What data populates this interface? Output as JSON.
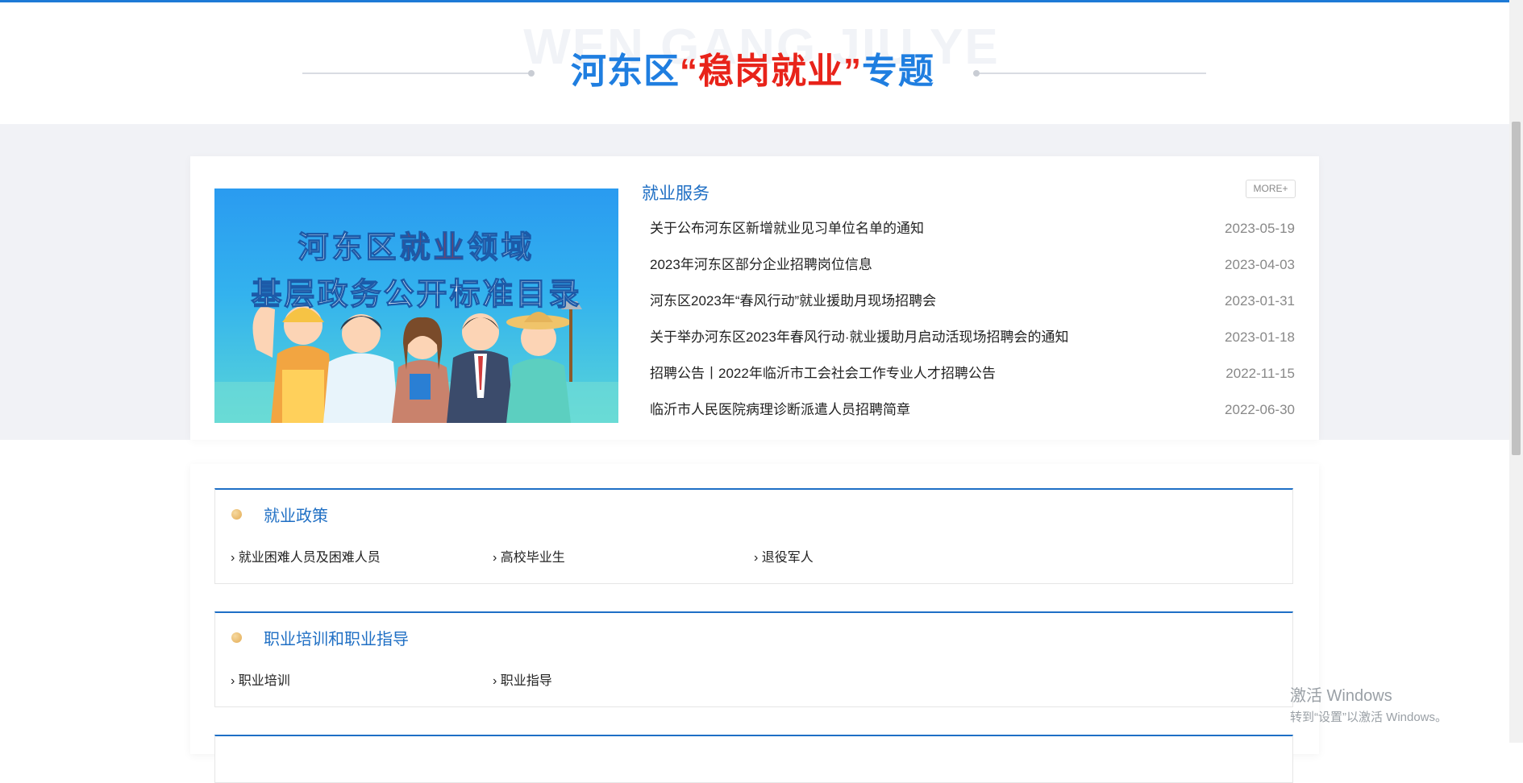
{
  "header": {
    "watermark": "WEN GANG JIU YE",
    "title_part1": "河东区",
    "title_quoted": "“稳岗就业”",
    "title_part2": "专题"
  },
  "banner": {
    "line1_part1": "河东区",
    "line1_highlight": "就业",
    "line1_part2": "领域",
    "line2": "基层政务公开标准目录"
  },
  "employment_service": {
    "title": "就业服务",
    "more_label": "MORE+",
    "items": [
      {
        "title": "关于公布河东区新增就业见习单位名单的通知",
        "date": "2023-05-19"
      },
      {
        "title": "2023年河东区部分企业招聘岗位信息",
        "date": "2023-04-03"
      },
      {
        "title": "河东区2023年“春风行动”就业援助月现场招聘会",
        "date": "2023-01-31"
      },
      {
        "title": "关于举办河东区2023年春风行动·就业援助月启动活现场招聘会的通知",
        "date": "2023-01-18"
      },
      {
        "title": "招聘公告丨2022年临沂市工会社会工作专业人才招聘公告",
        "date": "2022-11-15"
      },
      {
        "title": "临沂市人民医院病理诊断派遣人员招聘简章",
        "date": "2022-06-30"
      }
    ]
  },
  "sections": [
    {
      "title": "就业政策",
      "links": [
        "› 就业困难人员及困难人员",
        "› 高校毕业生",
        "› 退役军人"
      ]
    },
    {
      "title": "职业培训和职业指导",
      "links": [
        "› 职业培训",
        "› 职业指导"
      ]
    }
  ],
  "os_watermark": {
    "line1": "激活 Windows",
    "line2": "转到“设置”以激活 Windows。"
  }
}
